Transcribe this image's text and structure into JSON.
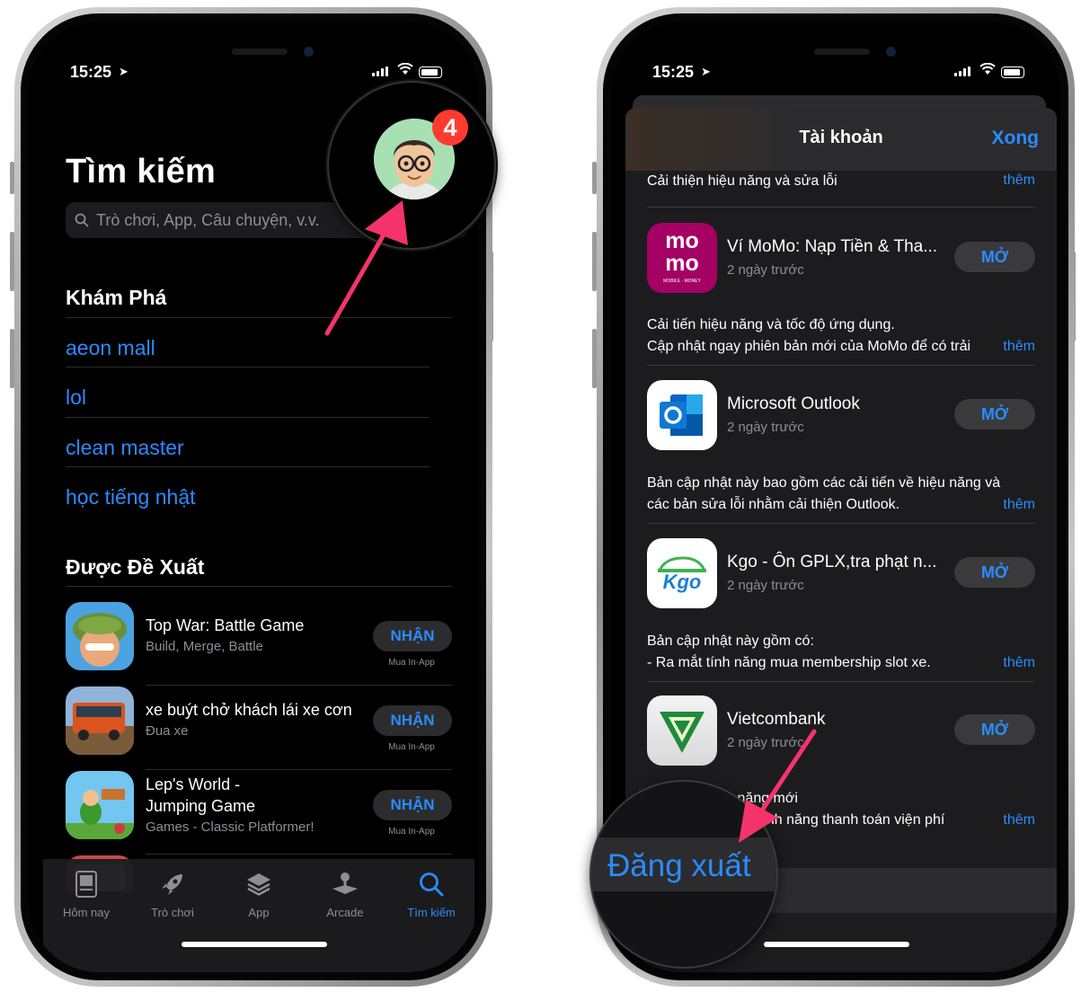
{
  "colors": {
    "accent": "#2a8cff",
    "badge": "#ff3b30",
    "arrow": "#f5336b"
  },
  "left": {
    "status": {
      "time": "15:25"
    },
    "title": "Tìm kiếm",
    "search": {
      "placeholder": "Trò chơi, App, Câu chuyện, v.v."
    },
    "badge": "4",
    "discover": {
      "title": "Khám Phá",
      "items": [
        "aeon mall",
        "lol",
        "clean master",
        "học tiếng nhật"
      ]
    },
    "suggested": {
      "title": "Được Đề Xuất",
      "apps": [
        {
          "name": "Top War: Battle Game",
          "subtitle": "Build, Merge, Battle",
          "button": "NHẬN",
          "note": "Mua In-App"
        },
        {
          "name": "xe buýt chở khách lái xe cơn",
          "subtitle": "Đua xe",
          "button": "NHẬN",
          "note": "Mua In-App"
        },
        {
          "name_line1": "Lep's World -",
          "name_line2": "Jumping Game",
          "subtitle": "Games - Classic Platformer!",
          "button": "NHẬN",
          "note": "Mua In-App"
        }
      ]
    },
    "tabs": [
      {
        "label": "Hôm nay",
        "icon": "today-icon"
      },
      {
        "label": "Trò chơi",
        "icon": "rocket-icon"
      },
      {
        "label": "App",
        "icon": "layers-icon"
      },
      {
        "label": "Arcade",
        "icon": "joystick-icon"
      },
      {
        "label": "Tìm kiếm",
        "icon": "search-icon",
        "active": true
      }
    ]
  },
  "right": {
    "status": {
      "time": "15:25"
    },
    "sheet": {
      "title": "Tài khoản",
      "done": "Xong"
    },
    "top_note": "Cải thiện hiệu năng và sửa lỗi",
    "more": "thêm",
    "updates": [
      {
        "name": "Ví MoMo: Nạp Tiền & Tha...",
        "date": "2 ngày trước",
        "button": "MỞ",
        "notes": [
          "Cải tiến hiệu năng và tốc độ ứng dụng.",
          "Cập nhật ngay phiên bản mới của MoMo để có trải"
        ]
      },
      {
        "name": "Microsoft Outlook",
        "date": "2 ngày trước",
        "button": "MỞ",
        "notes": [
          "Bản cập nhật này bao gồm các cải tiến về hiệu năng và",
          "các bản sửa lỗi nhằm cải thiện Outlook."
        ]
      },
      {
        "name": "Kgo - Ôn GPLX,tra phạt n...",
        "date": "2 ngày trước",
        "button": "MỞ",
        "notes": [
          "Bản cập nhật này gồm có:",
          "- Ra mắt tính năng mua membership slot xe."
        ]
      },
      {
        "name": "Vietcombank",
        "date": "2 ngày trước",
        "button": "MỞ",
        "notes": [
          "Cập nhật tính năng mới",
          "tính năng thanh toán viện phí"
        ]
      }
    ],
    "momo_logo": [
      "mo",
      "mo",
      "MOBILE · MONEY"
    ],
    "kgo_logo": "Kgo",
    "signout": "Đăng xuất"
  }
}
